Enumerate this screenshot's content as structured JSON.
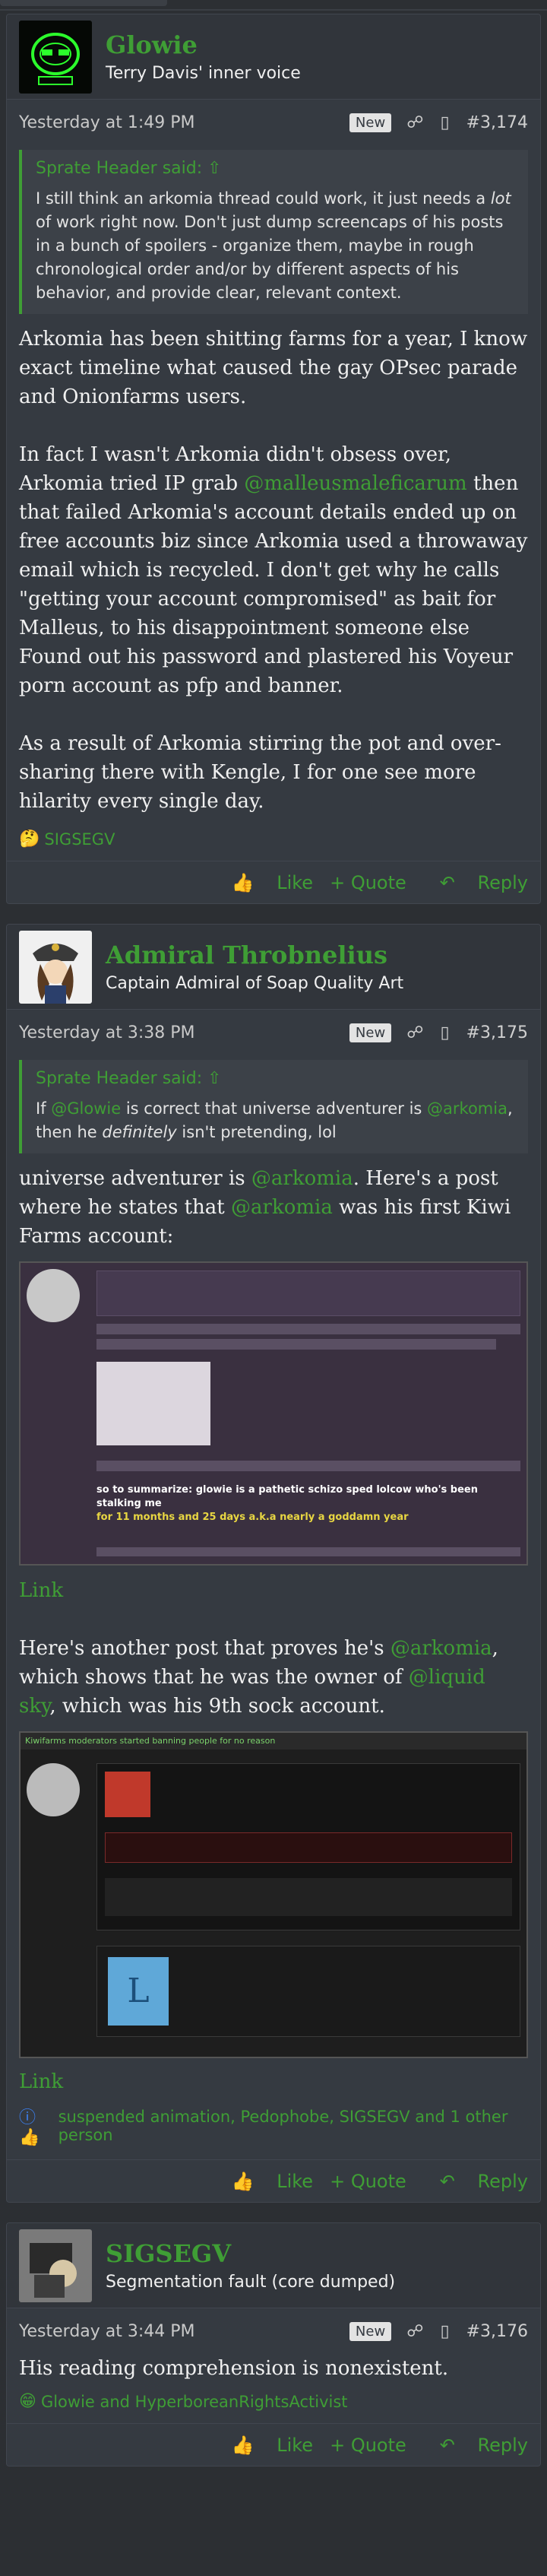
{
  "posts": [
    {
      "username": "Glowie",
      "user_title": "Terry Davis' inner voice",
      "time": "Yesterday at 1:49 PM",
      "new_badge": "New",
      "number": "#3,174",
      "quote_header": "Sprate Header said:",
      "quote_text_1": "I still think an arkomia thread could work, it just needs a ",
      "quote_em": "lot",
      "quote_text_2": " of work right now. Don't just dump screencaps of his posts in a bunch of spoilers - organize them, maybe in rough chronological order and/or by different aspects of his behavior, and provide clear, relevant context.",
      "p1": "Arkomia has been shitting farms for a year, I know exact timeline what caused the gay OPsec parade and Onionfarms users.",
      "p2_a": "In fact I wasn't Arkomia didn't obsess over, Arkomia tried IP grab ",
      "p2_mention": "@malleusmaleficarum",
      "p2_b": " then that failed Arkomia's account details ended up on free accounts biz since Arkomia used a throwaway email which is recycled. I don't get why he calls \"getting your account compromised\" as bait for Malleus, to his disappointment someone else Found out his password and plastered his Voyeur porn account as pfp and banner.",
      "p3": "As a result of Arkomia stirring the pot and over-sharing there with Kengle, I for one see more hilarity every single day.",
      "reactions": "SIGSEGV",
      "like": "Like",
      "quote": "+ Quote",
      "reply": "Reply"
    },
    {
      "username": "Admiral Throbnelius",
      "user_title": "Captain Admiral of Soap Quality Art",
      "time": "Yesterday at 3:38 PM",
      "new_badge": "New",
      "number": "#3,175",
      "quote_header": "Sprate Header said:",
      "quote_a": "If ",
      "quote_m1": "@Glowie",
      "quote_b": " is correct that universe adventurer is ",
      "quote_m2": "@arkomia",
      "quote_c": ", then he ",
      "quote_em": "definitely",
      "quote_d": " isn't pretending, lol",
      "p1_a": "universe adventurer is ",
      "p1_m": "@arkomia",
      "p1_b": ". Here's a post where he states that ",
      "p1_m2": "@arkomia",
      "p1_c": " was his first Kiwi Farms account:",
      "shot1_text": "so to summarize: glowie is a pathetic schizo sped lolcow who's been stalking me",
      "shot1_text2": "for 11 months and 25 days a.k.a nearly a goddamn year",
      "link1": "Link",
      "p2_a": "Here's another post that proves he's ",
      "p2_m": "@arkomia",
      "p2_b": ", which shows that he was the owner of ",
      "p2_m2": "@liquid sky",
      "p2_c": ", which was his 9th sock account.",
      "shot2_title": "Kiwifarms moderators started banning people for no reason",
      "link2": "Link",
      "reactions": "suspended animation, Pedophobe, SIGSEGV and 1 other person",
      "like": "Like",
      "quote": "+ Quote",
      "reply": "Reply"
    },
    {
      "username": "SIGSEGV",
      "user_title": "Segmentation fault (core dumped)",
      "time": "Yesterday at 3:44 PM",
      "new_badge": "New",
      "number": "#3,176",
      "p1": "His reading comprehension is nonexistent.",
      "reactions": "Glowie and HyperboreanRightsActivist",
      "like": "Like",
      "quote": "+ Quote",
      "reply": "Reply"
    }
  ],
  "colors": {
    "accent": "#3f9e35",
    "bg": "#2c2f33",
    "panel": "#353a41"
  }
}
